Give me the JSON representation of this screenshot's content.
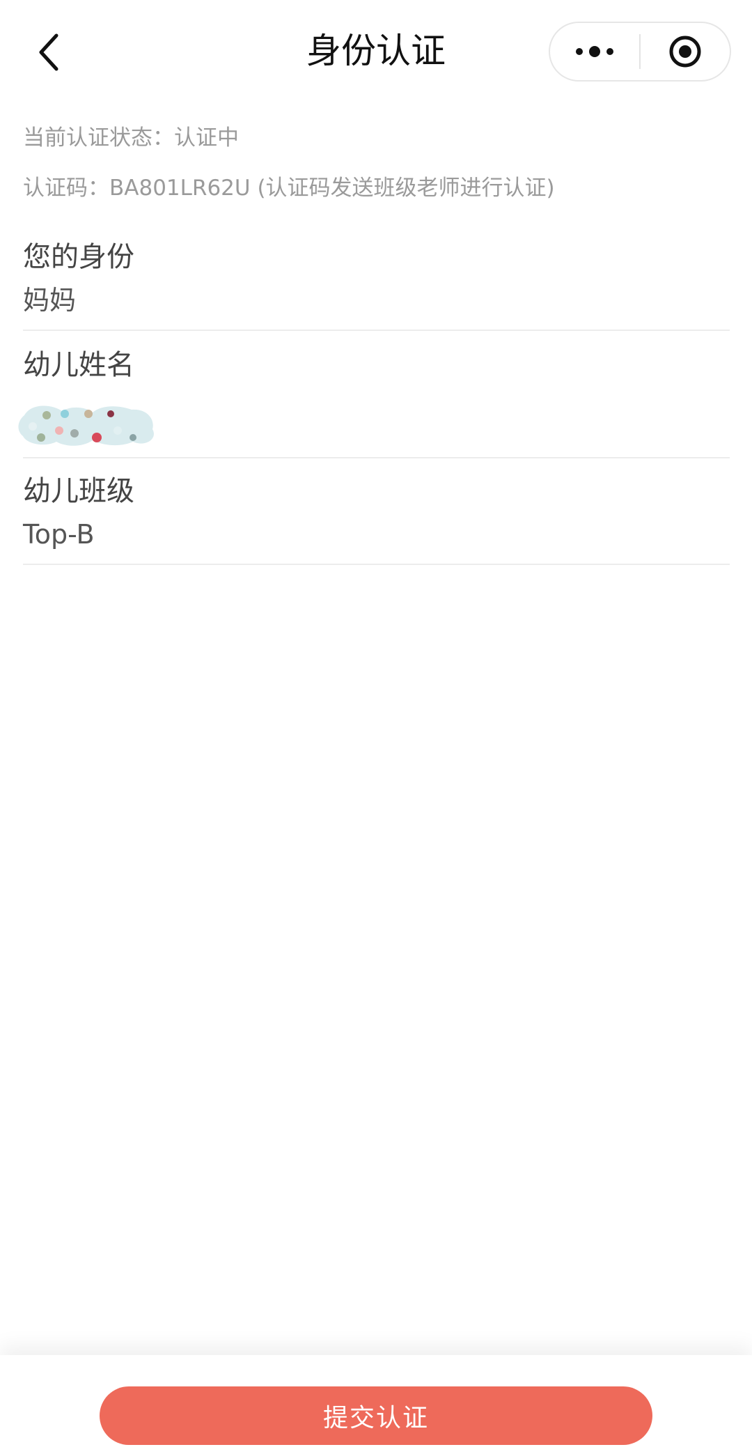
{
  "nav": {
    "title": "身份认证",
    "back_icon": "chevron-left-icon",
    "more_icon": "more-dots-icon",
    "close_icon": "target-close-icon"
  },
  "status": {
    "state_text": "当前认证状态：认证中",
    "code_text": "认证码：BA801LR62U (认证码发送班级老师进行认证)"
  },
  "fields": [
    {
      "label": "您的身份",
      "value": "妈妈"
    },
    {
      "label": "幼儿姓名",
      "value": ""
    },
    {
      "label": "幼儿班级",
      "value": "Top-B"
    }
  ],
  "submit": {
    "label": "提交认证",
    "color": "#ee6a5a"
  },
  "colors": {
    "title": "#111111",
    "label": "#444444",
    "muted": "#9a9a9a",
    "divider": "#ececec"
  }
}
